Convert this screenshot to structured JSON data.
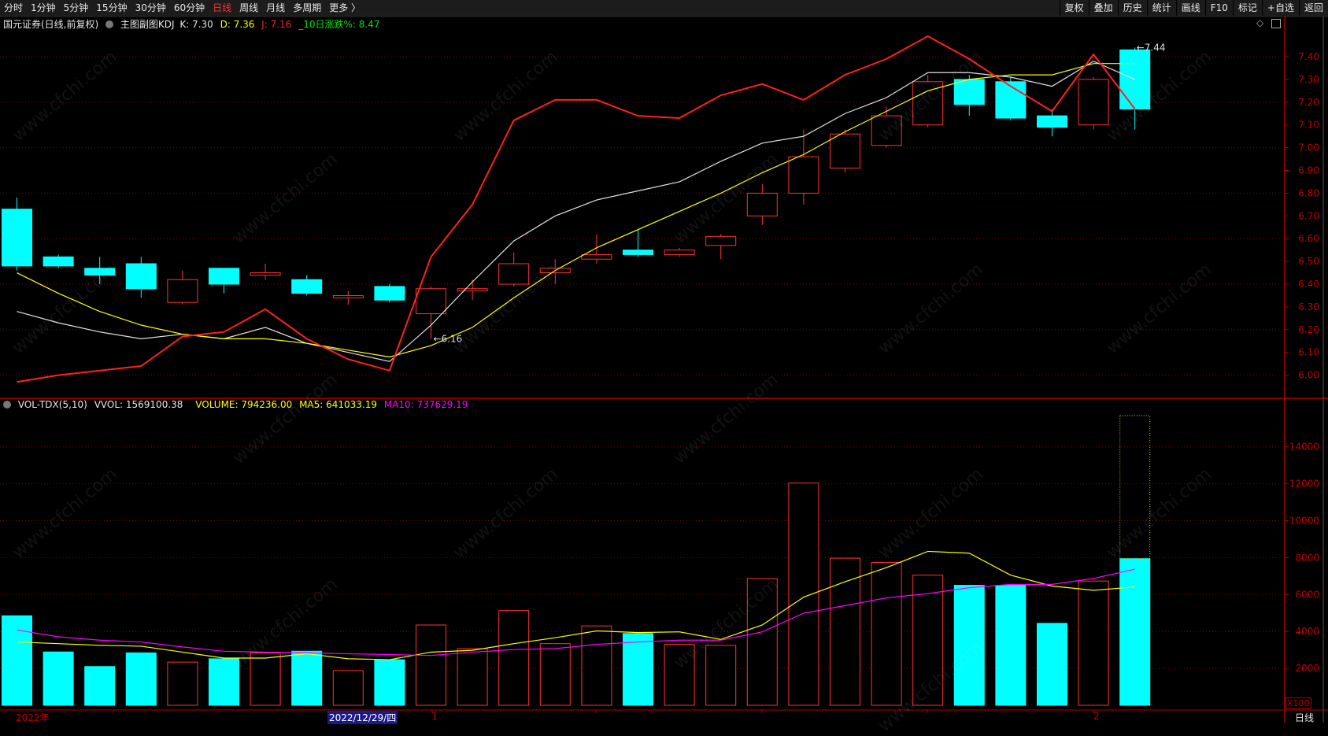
{
  "toolbar": {
    "periods": [
      "分时",
      "1分钟",
      "5分钟",
      "15分钟",
      "30分钟",
      "60分钟",
      "日线",
      "周线",
      "月线",
      "多周期",
      "更多 〉"
    ],
    "active_period": "日线",
    "actions": [
      "复权",
      "叠加",
      "历史",
      "统计",
      "画线",
      "F10",
      "标记",
      "+自选",
      "返回"
    ]
  },
  "main_header": {
    "title": "国元证券(日线,前复权)",
    "indicator": "主图副图KDJ",
    "k": "K: 7.30",
    "d": "D: 7.36",
    "j": "J: 7.16",
    "change10": "_10日涨跌%: 8.47"
  },
  "vol_header": {
    "name": "VOL-TDX(5,10)",
    "vvol": "VVOL: 1569100.38",
    "volume": "VOLUME: 794236.00",
    "ma5": "MA5: 641033.19",
    "ma10": "MA10: 737629.19"
  },
  "colors": {
    "up": "#ff3232",
    "down": "#00ffff",
    "k": "#e0e0e0",
    "d": "#ffff00",
    "j": "#ff2020",
    "ma5": "#ffff00",
    "ma10": "#ff00ff",
    "axis": "#b00000"
  },
  "watermark": "www.cfchi.com",
  "annotations": {
    "low": "6.16",
    "high": "7.44"
  },
  "x_axis": {
    "year": "2022年",
    "cursor_date": "2022/12/29/四",
    "m1": "1",
    "m2": "2",
    "period": "日线",
    "unit": "X100"
  },
  "chart_data": [
    {
      "type": "candlestick",
      "y_ticks": [
        "7.40",
        "7.30",
        "7.20",
        "7.10",
        "7.00",
        "6.90",
        "6.80",
        "6.70",
        "6.60",
        "6.50",
        "6.40",
        "6.30",
        "6.20",
        "6.10",
        "6.00"
      ],
      "ylim": [
        5.95,
        7.5
      ],
      "ohlc": [
        [
          6.73,
          6.78,
          6.46,
          6.48
        ],
        [
          6.52,
          6.53,
          6.47,
          6.48
        ],
        [
          6.47,
          6.52,
          6.4,
          6.44
        ],
        [
          6.49,
          6.52,
          6.34,
          6.38
        ],
        [
          6.32,
          6.46,
          6.31,
          6.42
        ],
        [
          6.47,
          6.47,
          6.36,
          6.4
        ],
        [
          6.44,
          6.49,
          6.42,
          6.45
        ],
        [
          6.42,
          6.44,
          6.35,
          6.36
        ],
        [
          6.34,
          6.37,
          6.31,
          6.35
        ],
        [
          6.39,
          6.4,
          6.32,
          6.33
        ],
        [
          6.27,
          6.39,
          6.16,
          6.38
        ],
        [
          6.37,
          6.42,
          6.33,
          6.38
        ],
        [
          6.4,
          6.54,
          6.39,
          6.49
        ],
        [
          6.45,
          6.51,
          6.4,
          6.47
        ],
        [
          6.51,
          6.62,
          6.49,
          6.53
        ],
        [
          6.55,
          6.64,
          6.52,
          6.53
        ],
        [
          6.53,
          6.56,
          6.52,
          6.55
        ],
        [
          6.57,
          6.62,
          6.51,
          6.61
        ],
        [
          6.7,
          6.84,
          6.66,
          6.8
        ],
        [
          6.8,
          7.08,
          6.75,
          6.96
        ],
        [
          6.91,
          7.08,
          6.89,
          7.06
        ],
        [
          7.01,
          7.18,
          7.0,
          7.14
        ],
        [
          7.1,
          7.32,
          7.09,
          7.29
        ],
        [
          7.3,
          7.32,
          7.14,
          7.19
        ],
        [
          7.29,
          7.31,
          7.12,
          7.13
        ],
        [
          7.14,
          7.17,
          7.05,
          7.09
        ],
        [
          7.1,
          7.31,
          7.08,
          7.3
        ],
        [
          7.43,
          7.44,
          7.08,
          7.17
        ]
      ],
      "series": [
        {
          "name": "K",
          "values": [
            6.28,
            6.23,
            6.19,
            6.16,
            6.18,
            6.16,
            6.21,
            6.14,
            6.1,
            6.06,
            6.22,
            6.41,
            6.59,
            6.7,
            6.77,
            6.81,
            6.85,
            6.94,
            7.02,
            7.05,
            7.15,
            7.22,
            7.33,
            7.33,
            7.31,
            7.27,
            7.38,
            7.3
          ]
        },
        {
          "name": "D",
          "values": [
            6.45,
            6.36,
            6.28,
            6.22,
            6.18,
            6.16,
            6.16,
            6.14,
            6.11,
            6.08,
            6.13,
            6.21,
            6.34,
            6.46,
            6.56,
            6.64,
            6.72,
            6.8,
            6.89,
            6.97,
            7.07,
            7.16,
            7.25,
            7.3,
            7.32,
            7.32,
            7.37,
            7.37
          ]
        },
        {
          "name": "J",
          "values": [
            5.97,
            6.0,
            6.02,
            6.04,
            6.17,
            6.19,
            6.29,
            6.16,
            6.07,
            6.02,
            6.52,
            6.75,
            7.12,
            7.21,
            7.21,
            7.14,
            7.13,
            7.23,
            7.28,
            7.21,
            7.32,
            7.39,
            7.49,
            7.39,
            7.27,
            7.16,
            7.41,
            7.17
          ]
        }
      ]
    },
    {
      "type": "bar",
      "y_ticks": [
        "14000",
        "12000",
        "10000",
        "8000",
        "6000",
        "4000",
        "2000"
      ],
      "ylim": [
        0,
        16000
      ],
      "volume": [
        4850,
        2890,
        2100,
        2840,
        2340,
        2520,
        2840,
        2930,
        1880,
        2470,
        4350,
        3070,
        5130,
        3340,
        4300,
        3890,
        3300,
        3250,
        6870,
        12040,
        7970,
        7740,
        7050,
        6500,
        6500,
        4440,
        6730,
        7942
      ],
      "vvol_last": 15691,
      "series": [
        {
          "name": "MA5",
          "values": [
            3430,
            3340,
            3250,
            3200,
            2880,
            2560,
            2560,
            2790,
            2520,
            2470,
            2880,
            2980,
            3340,
            3660,
            4030,
            3940,
            3980,
            3570,
            4350,
            5860,
            6690,
            7460,
            8340,
            8240,
            7050,
            6460,
            6230,
            6410
          ]
        },
        {
          "name": "MA10",
          "values": [
            4080,
            3710,
            3530,
            3430,
            3160,
            2930,
            2880,
            2840,
            2790,
            2750,
            2700,
            2880,
            3020,
            3070,
            3300,
            3430,
            3530,
            3530,
            3980,
            4990,
            5400,
            5820,
            6050,
            6370,
            6550,
            6550,
            6870,
            7376
          ]
        }
      ]
    }
  ]
}
